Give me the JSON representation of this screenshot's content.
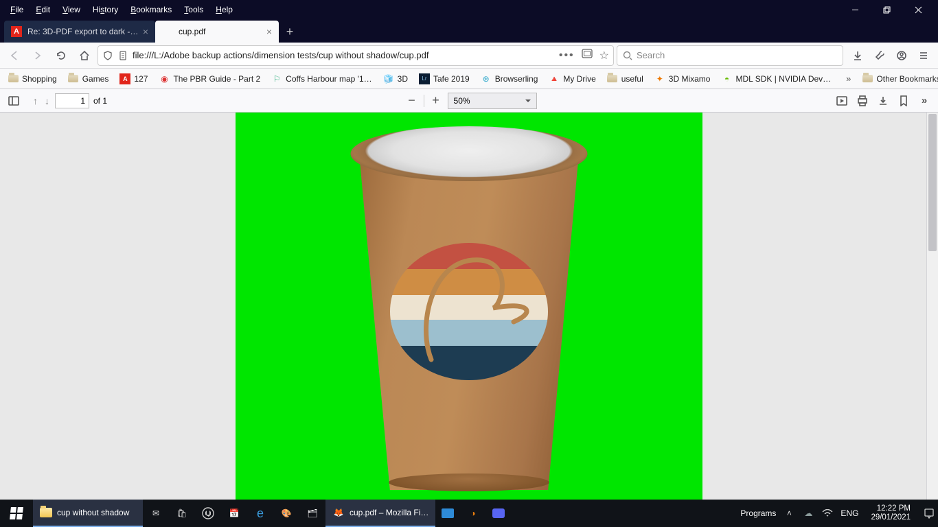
{
  "menu": {
    "file": "File",
    "edit": "Edit",
    "view": "View",
    "history": "History",
    "bookmarks": "Bookmarks",
    "tools": "Tools",
    "help": "Help"
  },
  "tabs": {
    "inactive": {
      "title": "Re: 3D-PDF export to dark - Ad…"
    },
    "active": {
      "title": "cup.pdf"
    }
  },
  "url": {
    "path": "file:///L:/Adobe backup actions/dimension tests/cup without shadow/cup.pdf"
  },
  "search": {
    "placeholder": "Search"
  },
  "bookmarks": [
    {
      "label": "Shopping"
    },
    {
      "label": "Games"
    },
    {
      "label": "127"
    },
    {
      "label": "The PBR Guide - Part 2"
    },
    {
      "label": "Coffs Harbour map '1…"
    },
    {
      "label": "3D"
    },
    {
      "label": "Tafe 2019"
    },
    {
      "label": "Browserling"
    },
    {
      "label": "My Drive"
    },
    {
      "label": "useful"
    },
    {
      "label": "3D Mixamo"
    },
    {
      "label": "MDL SDK | NVIDIA Dev…"
    }
  ],
  "bookbar": {
    "other": "Other Bookmarks"
  },
  "pdf": {
    "page": "1",
    "of": "of 1",
    "zoom": "50%"
  },
  "taskbar": {
    "explorer": "cup without shadow",
    "firefox": "cup.pdf – Mozilla Fi…",
    "programs": "Programs",
    "lang": "ENG",
    "time": "12:22 PM",
    "date": "29/01/2021"
  }
}
